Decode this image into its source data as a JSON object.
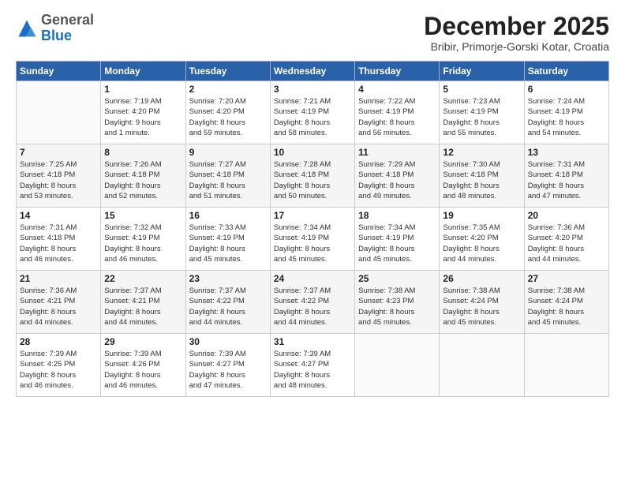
{
  "logo": {
    "general": "General",
    "blue": "Blue"
  },
  "header": {
    "month": "December 2025",
    "location": "Bribir, Primorje-Gorski Kotar, Croatia"
  },
  "weekdays": [
    "Sunday",
    "Monday",
    "Tuesday",
    "Wednesday",
    "Thursday",
    "Friday",
    "Saturday"
  ],
  "weeks": [
    [
      {
        "day": "",
        "info": ""
      },
      {
        "day": "1",
        "info": "Sunrise: 7:19 AM\nSunset: 4:20 PM\nDaylight: 9 hours\nand 1 minute."
      },
      {
        "day": "2",
        "info": "Sunrise: 7:20 AM\nSunset: 4:20 PM\nDaylight: 8 hours\nand 59 minutes."
      },
      {
        "day": "3",
        "info": "Sunrise: 7:21 AM\nSunset: 4:19 PM\nDaylight: 8 hours\nand 58 minutes."
      },
      {
        "day": "4",
        "info": "Sunrise: 7:22 AM\nSunset: 4:19 PM\nDaylight: 8 hours\nand 56 minutes."
      },
      {
        "day": "5",
        "info": "Sunrise: 7:23 AM\nSunset: 4:19 PM\nDaylight: 8 hours\nand 55 minutes."
      },
      {
        "day": "6",
        "info": "Sunrise: 7:24 AM\nSunset: 4:19 PM\nDaylight: 8 hours\nand 54 minutes."
      }
    ],
    [
      {
        "day": "7",
        "info": "Sunrise: 7:25 AM\nSunset: 4:18 PM\nDaylight: 8 hours\nand 53 minutes."
      },
      {
        "day": "8",
        "info": "Sunrise: 7:26 AM\nSunset: 4:18 PM\nDaylight: 8 hours\nand 52 minutes."
      },
      {
        "day": "9",
        "info": "Sunrise: 7:27 AM\nSunset: 4:18 PM\nDaylight: 8 hours\nand 51 minutes."
      },
      {
        "day": "10",
        "info": "Sunrise: 7:28 AM\nSunset: 4:18 PM\nDaylight: 8 hours\nand 50 minutes."
      },
      {
        "day": "11",
        "info": "Sunrise: 7:29 AM\nSunset: 4:18 PM\nDaylight: 8 hours\nand 49 minutes."
      },
      {
        "day": "12",
        "info": "Sunrise: 7:30 AM\nSunset: 4:18 PM\nDaylight: 8 hours\nand 48 minutes."
      },
      {
        "day": "13",
        "info": "Sunrise: 7:31 AM\nSunset: 4:18 PM\nDaylight: 8 hours\nand 47 minutes."
      }
    ],
    [
      {
        "day": "14",
        "info": "Sunrise: 7:31 AM\nSunset: 4:18 PM\nDaylight: 8 hours\nand 46 minutes."
      },
      {
        "day": "15",
        "info": "Sunrise: 7:32 AM\nSunset: 4:19 PM\nDaylight: 8 hours\nand 46 minutes."
      },
      {
        "day": "16",
        "info": "Sunrise: 7:33 AM\nSunset: 4:19 PM\nDaylight: 8 hours\nand 45 minutes."
      },
      {
        "day": "17",
        "info": "Sunrise: 7:34 AM\nSunset: 4:19 PM\nDaylight: 8 hours\nand 45 minutes."
      },
      {
        "day": "18",
        "info": "Sunrise: 7:34 AM\nSunset: 4:19 PM\nDaylight: 8 hours\nand 45 minutes."
      },
      {
        "day": "19",
        "info": "Sunrise: 7:35 AM\nSunset: 4:20 PM\nDaylight: 8 hours\nand 44 minutes."
      },
      {
        "day": "20",
        "info": "Sunrise: 7:36 AM\nSunset: 4:20 PM\nDaylight: 8 hours\nand 44 minutes."
      }
    ],
    [
      {
        "day": "21",
        "info": "Sunrise: 7:36 AM\nSunset: 4:21 PM\nDaylight: 8 hours\nand 44 minutes."
      },
      {
        "day": "22",
        "info": "Sunrise: 7:37 AM\nSunset: 4:21 PM\nDaylight: 8 hours\nand 44 minutes."
      },
      {
        "day": "23",
        "info": "Sunrise: 7:37 AM\nSunset: 4:22 PM\nDaylight: 8 hours\nand 44 minutes."
      },
      {
        "day": "24",
        "info": "Sunrise: 7:37 AM\nSunset: 4:22 PM\nDaylight: 8 hours\nand 44 minutes."
      },
      {
        "day": "25",
        "info": "Sunrise: 7:38 AM\nSunset: 4:23 PM\nDaylight: 8 hours\nand 45 minutes."
      },
      {
        "day": "26",
        "info": "Sunrise: 7:38 AM\nSunset: 4:24 PM\nDaylight: 8 hours\nand 45 minutes."
      },
      {
        "day": "27",
        "info": "Sunrise: 7:38 AM\nSunset: 4:24 PM\nDaylight: 8 hours\nand 45 minutes."
      }
    ],
    [
      {
        "day": "28",
        "info": "Sunrise: 7:39 AM\nSunset: 4:25 PM\nDaylight: 8 hours\nand 46 minutes."
      },
      {
        "day": "29",
        "info": "Sunrise: 7:39 AM\nSunset: 4:26 PM\nDaylight: 8 hours\nand 46 minutes."
      },
      {
        "day": "30",
        "info": "Sunrise: 7:39 AM\nSunset: 4:27 PM\nDaylight: 8 hours\nand 47 minutes."
      },
      {
        "day": "31",
        "info": "Sunrise: 7:39 AM\nSunset: 4:27 PM\nDaylight: 8 hours\nand 48 minutes."
      },
      {
        "day": "",
        "info": ""
      },
      {
        "day": "",
        "info": ""
      },
      {
        "day": "",
        "info": ""
      }
    ]
  ]
}
